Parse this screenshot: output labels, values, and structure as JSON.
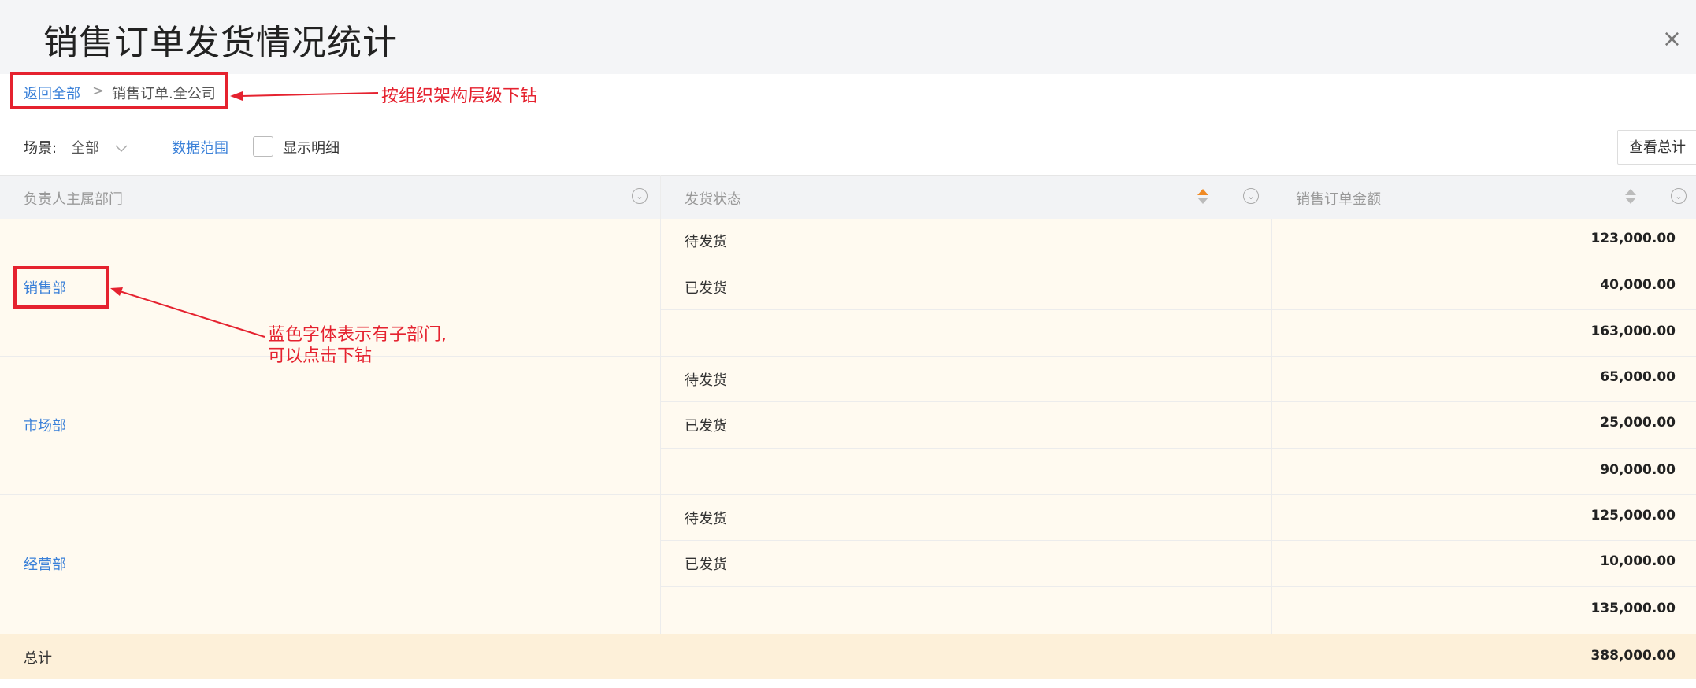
{
  "header": {
    "title": "销售订单发货情况统计",
    "close": "×"
  },
  "breadcrumb": {
    "back": "返回全部",
    "separator": ">",
    "current": "销售订单.全公司"
  },
  "annotations": {
    "breadcrumb_note": "按组织架构层级下钻",
    "dept_note_line1": "蓝色字体表示有子部门,",
    "dept_note_line2": "可以点击下钻"
  },
  "toolbar": {
    "scene_label": "场景:",
    "scene_value": "全部",
    "data_range": "数据范围",
    "show_detail": "显示明细",
    "view_total": "查看总计"
  },
  "columns": [
    "负责人主属部门",
    "发货状态",
    "销售订单金额"
  ],
  "groups": [
    {
      "dept": "销售部",
      "rows": [
        {
          "status": "待发货",
          "amount": "123,000.00"
        },
        {
          "status": "已发货",
          "amount": "40,000.00"
        },
        {
          "status": "",
          "amount": "163,000.00"
        }
      ]
    },
    {
      "dept": "市场部",
      "rows": [
        {
          "status": "待发货",
          "amount": "65,000.00"
        },
        {
          "status": "已发货",
          "amount": "25,000.00"
        },
        {
          "status": "",
          "amount": "90,000.00"
        }
      ]
    },
    {
      "dept": "经营部",
      "rows": [
        {
          "status": "待发货",
          "amount": "125,000.00"
        },
        {
          "status": "已发货",
          "amount": "10,000.00"
        },
        {
          "status": "",
          "amount": "135,000.00"
        }
      ]
    }
  ],
  "total": {
    "label": "总计",
    "amount": "388,000.00"
  },
  "colors": {
    "accent": "#3a80d8",
    "annotation_red": "#e5222f",
    "sort_active": "#f08a24",
    "row_bg": "#fffaf0",
    "total_bg": "#fdf0d9"
  }
}
